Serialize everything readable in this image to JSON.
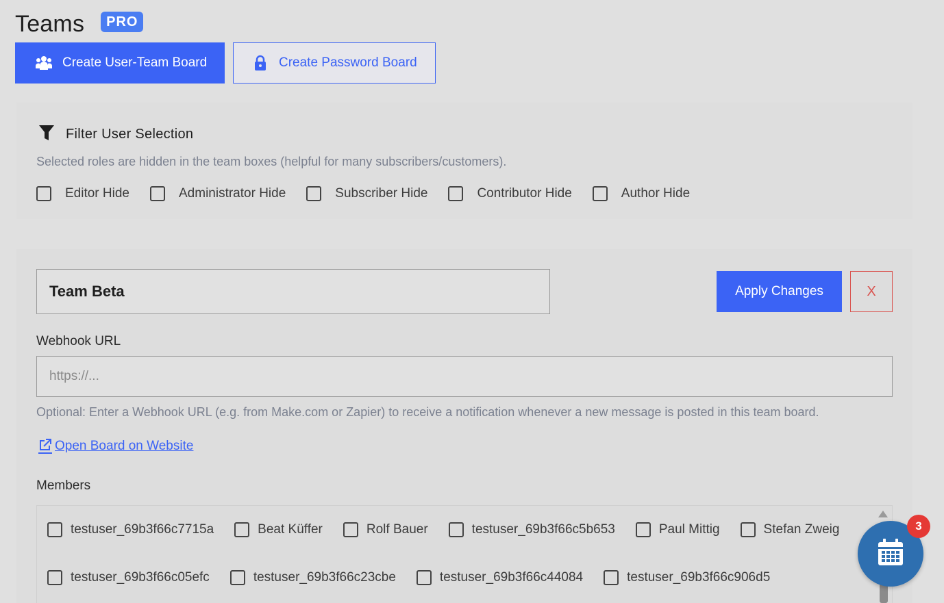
{
  "header": {
    "title": "Teams",
    "badge": "PRO"
  },
  "buttons": {
    "create_user_team": "Create User-Team Board",
    "create_password": "Create Password Board"
  },
  "filter": {
    "title": "Filter User Selection",
    "description": "Selected roles are hidden in the team boxes (helpful for many subscribers/customers).",
    "roles": [
      "Editor Hide",
      "Administrator Hide",
      "Subscriber Hide",
      "Contributor Hide",
      "Author Hide"
    ]
  },
  "team": {
    "name": "Team Beta",
    "apply_label": "Apply Changes",
    "close_label": "X",
    "webhook_label": "Webhook URL",
    "webhook_placeholder": "https://...",
    "webhook_help": "Optional: Enter a Webhook URL (e.g. from Make.com or Zapier) to receive a notification whenever a new message is posted in this team board.",
    "open_link": "Open Board on Website",
    "members_label": "Members",
    "members_row1": [
      "testuser_69b3f66c7715a",
      "Beat Küffer",
      "Rolf Bauer",
      "testuser_69b3f66c5b653",
      "Paul Mittig",
      "Stefan Zweig"
    ],
    "members_row2": [
      "testuser_69b3f66c05efc",
      "testuser_69b3f66c23cbe",
      "testuser_69b3f66c44084",
      "testuser_69b3f66c906d5"
    ]
  },
  "fab": {
    "badge_count": "3",
    "icon": "calendar-icon"
  },
  "colors": {
    "accent": "#3b63f5",
    "badge": "#4a7df2",
    "danger": "#d9534f",
    "fab": "#2e6fb0",
    "notification": "#e53935"
  }
}
